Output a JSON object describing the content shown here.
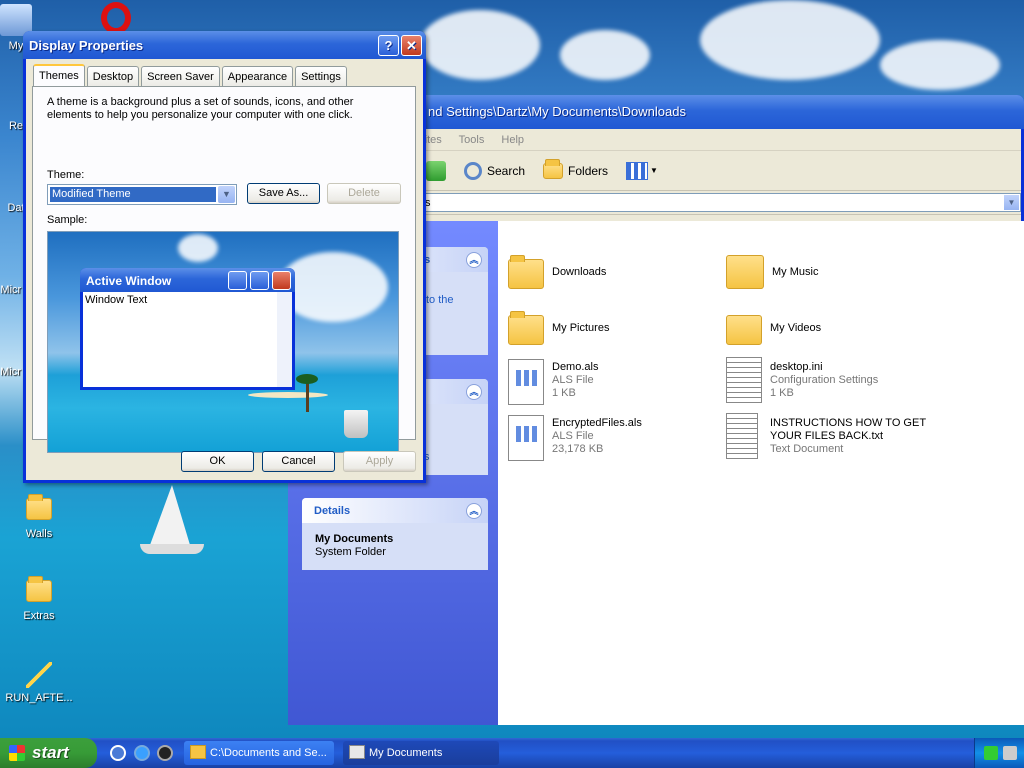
{
  "desktop": {
    "icons": [
      {
        "label": "My",
        "icon": "my-computer-icon"
      },
      {
        "label": "Re",
        "icon": "recycle-bin-icon"
      },
      {
        "label": "Dat",
        "icon": "data-icon"
      },
      {
        "label": "Micr B",
        "icon": "program-icon"
      },
      {
        "label": "Micr C",
        "icon": "program-icon"
      },
      {
        "label": "Walls",
        "icon": "folder-icon"
      },
      {
        "label": "Extras",
        "icon": "folder-icon"
      },
      {
        "label": "RUN_AFTE...",
        "icon": "wand-icon"
      }
    ]
  },
  "explorer": {
    "title": "nd Settings\\Dartz\\My Documents\\Downloads",
    "menu": [
      "rites",
      "Tools",
      "Help"
    ],
    "toolbar": {
      "search_label": "Search",
      "folders_label": "Folders"
    },
    "address": "ts",
    "left_pane": {
      "tasks_title": "ks",
      "tasks_text": "to the",
      "middle_link": "s",
      "details_title": "Details",
      "details_name": "My Documents",
      "details_type": "System Folder"
    },
    "items": [
      {
        "name": "Downloads",
        "icon": "folder-icon"
      },
      {
        "name": "My Music",
        "icon": "music-folder-icon"
      },
      {
        "name": "My Pictures",
        "icon": "folder-icon"
      },
      {
        "name": "My Videos",
        "icon": "folder-icon"
      },
      {
        "name": "Demo.als",
        "type": "ALS File",
        "size": "1 KB",
        "icon": "als-file-icon"
      },
      {
        "name": "desktop.ini",
        "type": "Configuration Settings",
        "size": "1 KB",
        "icon": "ini-file-icon"
      },
      {
        "name": "EncryptedFiles.als",
        "type": "ALS File",
        "size": "23,178 KB",
        "icon": "als-file-icon"
      },
      {
        "name": "INSTRUCTIONS HOW TO GET",
        "name2": "YOUR FILES BACK.txt",
        "type": "Text Document",
        "icon": "text-file-icon"
      }
    ]
  },
  "dialog": {
    "title": "Display Properties",
    "help_glyph": "?",
    "close_glyph": "✕",
    "tabs": [
      "Themes",
      "Desktop",
      "Screen Saver",
      "Appearance",
      "Settings"
    ],
    "description": "A theme is a background plus a set of sounds, icons, and other elements to help you personalize your computer with one click.",
    "theme_label": "Theme:",
    "theme_value": "Modified Theme",
    "save_as_label": "Save As...",
    "delete_label": "Delete",
    "sample_label": "Sample:",
    "sample": {
      "window_title": "Active Window",
      "window_text": "Window Text"
    },
    "ok_label": "OK",
    "cancel_label": "Cancel",
    "apply_label": "Apply"
  },
  "taskbar": {
    "start_label": "start",
    "buttons": [
      {
        "label": "C:\\Documents and Se...",
        "active": false
      },
      {
        "label": "My Documents",
        "active": true
      }
    ]
  },
  "colors": {
    "xp_blue": "#0831d9",
    "selection": "#316ac5",
    "start_green": "#379b37"
  }
}
